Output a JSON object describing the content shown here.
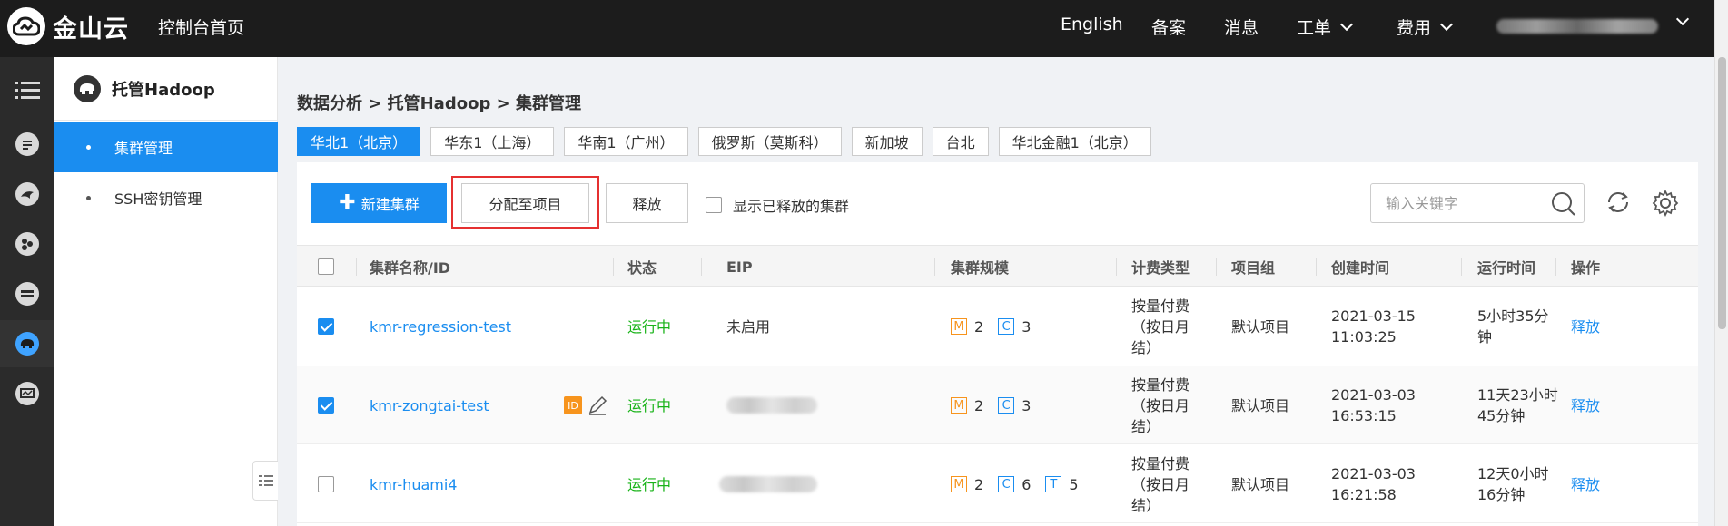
{
  "topbar": {
    "brand": "金山云",
    "console_home": "控制台首页",
    "nav": {
      "english": "English",
      "beian": "备案",
      "messages": "消息",
      "tickets": "工单",
      "billing": "费用"
    }
  },
  "sidebar": {
    "title": "托管Hadoop",
    "items": [
      {
        "label": "集群管理",
        "active": true
      },
      {
        "label": "SSH密钥管理",
        "active": false
      }
    ]
  },
  "rail_icons": [
    "menu-icon",
    "document-icon",
    "dolphin-icon",
    "cluster-icon",
    "server-icon",
    "hadoop-elephant-icon",
    "monitor-icon"
  ],
  "breadcrumb": "数据分析 > 托管Hadoop > 集群管理",
  "regions": [
    {
      "label": "华北1（北京）",
      "active": true
    },
    {
      "label": "华东1（上海）",
      "active": false
    },
    {
      "label": "华南1（广州）",
      "active": false
    },
    {
      "label": "俄罗斯（莫斯科）",
      "active": false
    },
    {
      "label": "新加坡",
      "active": false
    },
    {
      "label": "台北",
      "active": false
    },
    {
      "label": "华北金融1（北京）",
      "active": false
    }
  ],
  "toolbar": {
    "create_label": "新建集群",
    "assign_label": "分配至项目",
    "release_label": "释放",
    "show_released_label": "显示已释放的集群",
    "search_placeholder": "输入关键字"
  },
  "table": {
    "columns": {
      "name": "集群名称/ID",
      "status": "状态",
      "eip": "EIP",
      "scale": "集群规模",
      "billing": "计费类型",
      "project": "项目组",
      "created": "创建时间",
      "runtime": "运行时间",
      "action": "操作"
    },
    "rows": [
      {
        "checked": true,
        "name": "kmr-regression-test",
        "status": "运行中",
        "eip": "未启用",
        "eip_blurred": false,
        "scale": {
          "m_label": "M",
          "m": "2",
          "c_label": "C",
          "c": "3"
        },
        "billing_l1": "按量付费",
        "billing_l2": "（按日月",
        "billing_l3": "结）",
        "project": "默认项目",
        "created_date": "2021-03-15",
        "created_time": "11:03:25",
        "runtime_l1": "5小时35分",
        "runtime_l2": "钟",
        "action": "释放"
      },
      {
        "checked": true,
        "name": "kmr-zongtai-test",
        "id_badge": "ID",
        "status": "运行中",
        "eip": "",
        "eip_blurred": true,
        "scale": {
          "m_label": "M",
          "m": "2",
          "c_label": "C",
          "c": "3"
        },
        "billing_l1": "按量付费",
        "billing_l2": "（按日月",
        "billing_l3": "结）",
        "project": "默认项目",
        "created_date": "2021-03-03",
        "created_time": "16:53:15",
        "runtime_l1": "11天23小时",
        "runtime_l2": "45分钟",
        "action": "释放"
      },
      {
        "checked": false,
        "name": "kmr-huami4",
        "status": "运行中",
        "eip": "",
        "eip_blurred": true,
        "scale": {
          "m_label": "M",
          "m": "2",
          "c_label": "C",
          "c": "6",
          "t_label": "T",
          "t": "5"
        },
        "billing_l1": "按量付费",
        "billing_l2": "（按日月",
        "billing_l3": "结）",
        "project": "默认项目",
        "created_date": "2021-03-03",
        "created_time": "16:21:58",
        "runtime_l1": "12天0小时",
        "runtime_l2": "16分钟",
        "action": "释放"
      }
    ]
  },
  "colors": {
    "primary": "#1a8df0",
    "running": "#19b319",
    "highlight": "#e53030",
    "tag_master": "#f7941d"
  }
}
